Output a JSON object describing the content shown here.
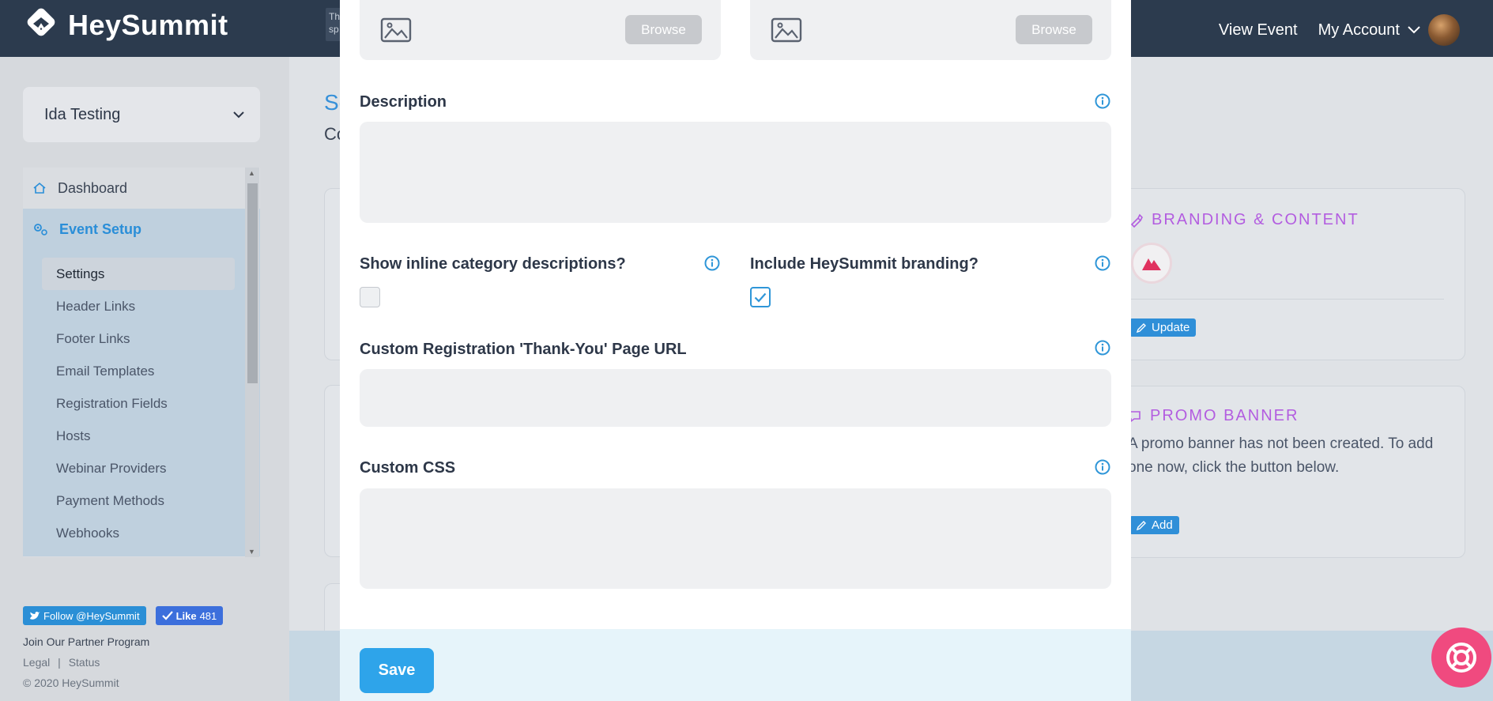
{
  "brand": {
    "name": "HeySummit"
  },
  "top_snippet": "Th sp",
  "topnav": {
    "view_event": "View Event",
    "my_account": "My Account"
  },
  "sidebar": {
    "event_name": "Ida Testing",
    "nav": [
      {
        "label": "Dashboard"
      },
      {
        "label": "Event Setup"
      }
    ],
    "sub_items": [
      {
        "label": "Settings"
      },
      {
        "label": "Header Links"
      },
      {
        "label": "Footer Links"
      },
      {
        "label": "Email Templates"
      },
      {
        "label": "Registration Fields"
      },
      {
        "label": "Hosts"
      },
      {
        "label": "Webinar Providers"
      },
      {
        "label": "Payment Methods"
      },
      {
        "label": "Webhooks"
      }
    ],
    "social": {
      "twitter": "Follow @HeySummit",
      "like": "Like",
      "like_count": "481"
    },
    "footer": {
      "partner": "Join Our Partner Program",
      "legal": "Legal",
      "sep": "|",
      "status": "Status",
      "copyright": "© 2020 HeySummit"
    }
  },
  "main": {
    "title_partial": "Se",
    "subtitle_partial": "Co",
    "branding_card": {
      "title": "BRANDING & CONTENT",
      "button": "Update"
    },
    "promo_card": {
      "title": "PROMO BANNER",
      "text": "A promo banner has not been created. To add one now, click the button below.",
      "button": "Add"
    }
  },
  "modal": {
    "browse_label": "Browse",
    "description": {
      "label": "Description",
      "value": ""
    },
    "inline_category": {
      "label": "Show inline category descriptions?",
      "checked": false
    },
    "branding": {
      "label": "Include HeySummit branding?",
      "checked": true
    },
    "thankyou_url": {
      "label": "Custom Registration 'Thank-You' Page URL",
      "value": ""
    },
    "custom_css": {
      "label": "Custom CSS",
      "value": ""
    },
    "save_label": "Save"
  },
  "colors": {
    "topbar": "#2c3b4e",
    "accent_blue": "#2ea4ea",
    "info_blue": "#2f96d8",
    "purple": "#b35de0",
    "help_pink": "#f04a7f"
  }
}
